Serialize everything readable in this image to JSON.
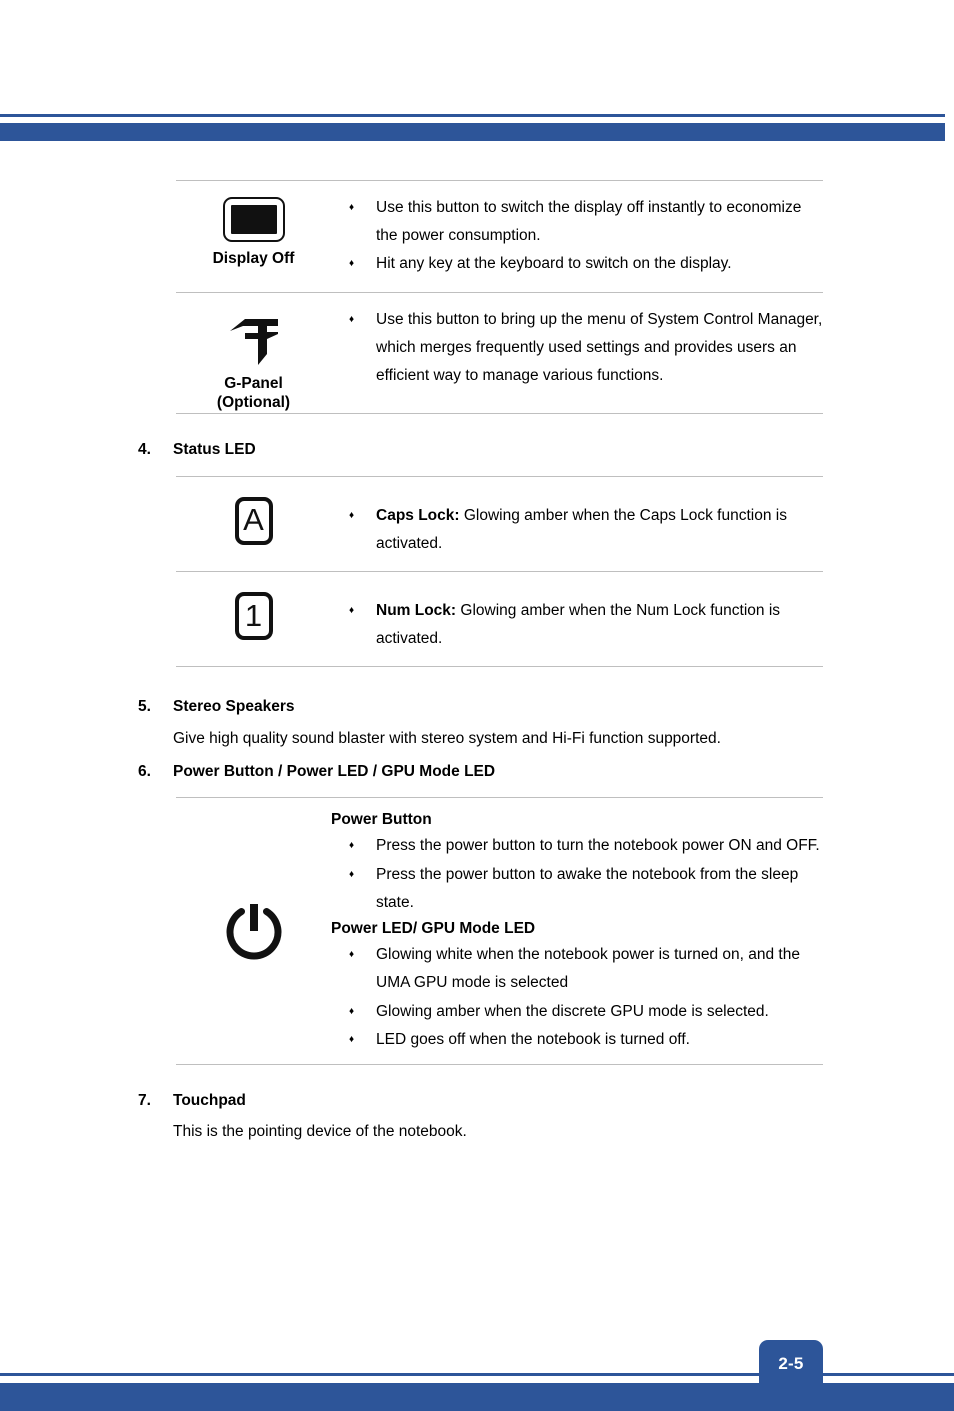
{
  "header": {
    "accent_color": "#2d5599"
  },
  "footer": {
    "page_number": "2-5",
    "accent_color": "#2d5599"
  },
  "blocks": {
    "display_off": {
      "icon": "display-off-icon",
      "caption": "Display Off",
      "bullets": [
        "Use this button to switch the display off instantly to economize the power consumption.",
        "Hit any key at the keyboard to switch on the display."
      ]
    },
    "g_panel": {
      "icon": "g-panel-logo-icon",
      "caption_line1": "G-Panel",
      "caption_line2": "(Optional)",
      "bullets": [
        "Use this button to bring up the menu of System Control Manager, which merges frequently used settings and provides users an efficient way to manage various functions."
      ]
    },
    "status_led": {
      "number": "4.",
      "title": "Status LED",
      "caps_lock": {
        "icon": "caps-lock-key-icon",
        "icon_glyph": "A",
        "label": "Caps Lock:",
        "text": " Glowing amber when the Caps Lock function is activated."
      },
      "num_lock": {
        "icon": "num-lock-key-icon",
        "icon_glyph": "1",
        "label": "Num Lock:",
        "text": " Glowing amber when the Num Lock function is activated."
      }
    },
    "stereo_speakers": {
      "number": "5.",
      "title": "Stereo Speakers",
      "body": "Give high quality sound blaster with stereo system and Hi-Fi function supported."
    },
    "power_button": {
      "number": "6.",
      "title": "Power Button / Power LED / GPU Mode LED",
      "icon": "power-symbol-icon",
      "sub_head_1": "Power Button",
      "bullets_1": [
        "Press the power button to turn the notebook power ON and OFF.",
        "Press the power button to awake the notebook from the sleep state."
      ],
      "sub_head_2": "Power LED/ GPU Mode LED",
      "bullets_2": [
        "Glowing white when the notebook power is turned on, and the UMA GPU mode is selected",
        "Glowing amber when the discrete GPU mode is selected.",
        "LED goes off when the notebook is turned off."
      ]
    },
    "touchpad": {
      "number": "7.",
      "title": "Touchpad",
      "body": "This is the pointing device of the notebook."
    }
  }
}
